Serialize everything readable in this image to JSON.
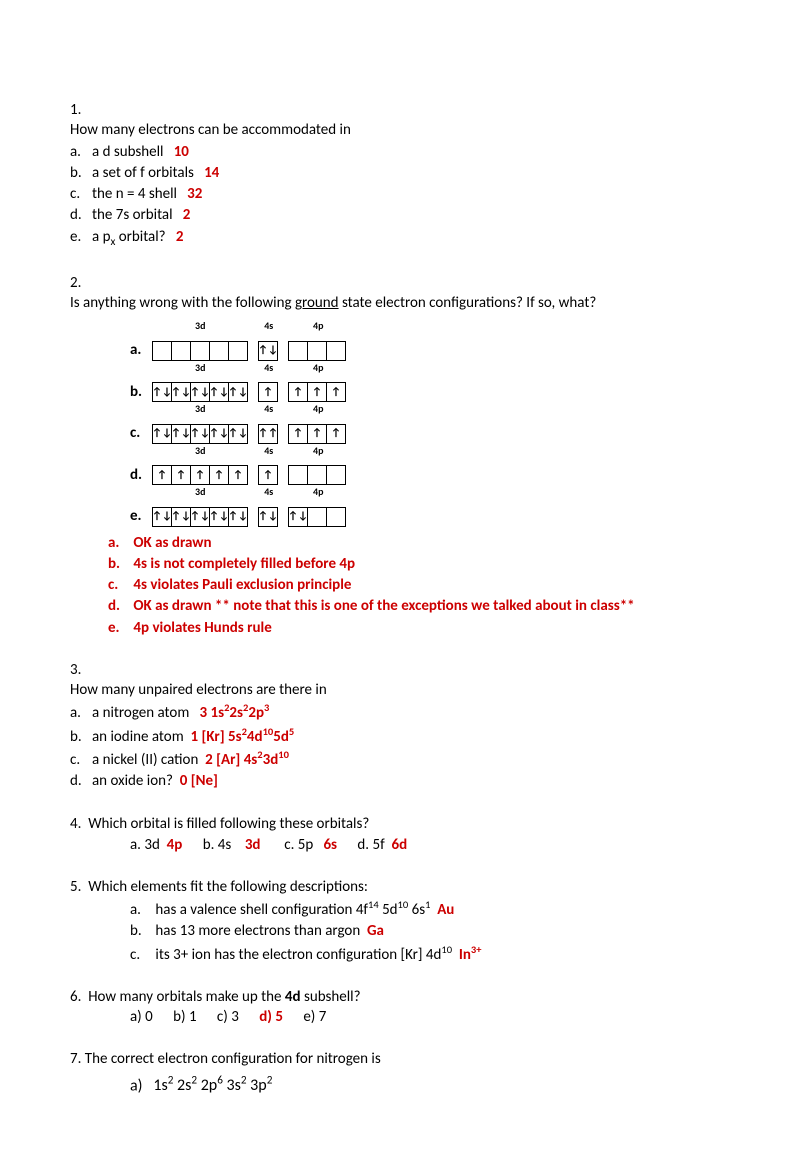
{
  "q1": {
    "num": "1.",
    "stem": "How many electrons can be accommodated in",
    "items": [
      {
        "let": "a.",
        "text": "a d subshell",
        "ans": "10"
      },
      {
        "let": "b.",
        "text": "a set of f orbitals",
        "ans": "14"
      },
      {
        "let": "c.",
        "text": "the n = 4 shell",
        "ans": "32"
      },
      {
        "let": "d.",
        "text": "the 7s orbital",
        "ans": "2"
      },
      {
        "let": "e.",
        "text_pre": "a p",
        "text_sub": "x",
        "text_post": " orbital?",
        "ans": "2"
      }
    ]
  },
  "q2": {
    "num": "2.",
    "stem_pre": "Is anything wrong with the following ",
    "stem_u": "ground",
    "stem_post": " state electron configurations?  If so, what?",
    "orbitals": {
      "headers": [
        "3d",
        "4s",
        "4p"
      ],
      "rows": [
        {
          "let": "a.",
          "d": [
            "",
            "",
            "",
            "",
            ""
          ],
          "s": [
            "↑↓"
          ],
          "p": [
            "",
            "",
            ""
          ]
        },
        {
          "let": "b.",
          "d": [
            "↑↓",
            "↑↓",
            "↑↓",
            "↑↓",
            "↑↓"
          ],
          "s": [
            "↑"
          ],
          "p": [
            "↑",
            "↑",
            "↑"
          ]
        },
        {
          "let": "c.",
          "d": [
            "↑↓",
            "↑↓",
            "↑↓",
            "↑↓",
            "↑↓"
          ],
          "s": [
            "↑↑"
          ],
          "p": [
            "↑",
            "↑",
            "↑"
          ]
        },
        {
          "let": "d.",
          "d": [
            "↑",
            "↑",
            "↑",
            "↑",
            "↑"
          ],
          "s": [
            "↑"
          ],
          "p": [
            "",
            "",
            ""
          ]
        },
        {
          "let": "e.",
          "d": [
            "↑↓",
            "↑↓",
            "↑↓",
            "↑↓",
            "↑↓"
          ],
          "s": [
            "↑↓"
          ],
          "p": [
            "↑↓",
            "",
            ""
          ]
        }
      ]
    },
    "answers": [
      {
        "let": "a.",
        "text": "OK as drawn"
      },
      {
        "let": "b.",
        "text": "4s is not completely filled before 4p"
      },
      {
        "let": "c.",
        "text": "4s violates Pauli exclusion principle"
      },
      {
        "let": "d.",
        "text": "OK as drawn  ** note that this is one of the exceptions we talked about in class**"
      },
      {
        "let": "e.",
        "text": "4p violates Hunds rule"
      }
    ]
  },
  "q3": {
    "num": "3.",
    "stem": "How many unpaired electrons are there in",
    "items": [
      {
        "let": "a.",
        "text": "a nitrogen atom",
        "ans": "3   1s",
        "cfg": [
          [
            "2",
            "2s"
          ],
          [
            "2",
            "2p"
          ],
          [
            "3",
            ""
          ]
        ]
      },
      {
        "let": "b.",
        "text": "an iodine atom",
        "ans": "1   [Kr] 5s",
        "cfg": [
          [
            "2",
            "4d"
          ],
          [
            "10",
            "5d"
          ],
          [
            "5",
            ""
          ]
        ]
      },
      {
        "let": "c.",
        "text": "a nickel (II) cation",
        "ans": "2   [Ar] 4s",
        "cfg": [
          [
            "2",
            "3d"
          ],
          [
            "10",
            ""
          ]
        ]
      },
      {
        "let": "d.",
        "text": "an oxide ion?",
        "ans": "0   [Ne]",
        "cfg": []
      }
    ]
  },
  "q4": {
    "num": "4.",
    "stem": "Which orbital is filled following these orbitals?",
    "opts": [
      {
        "let": "a.",
        "q": "3d",
        "ans": "4p"
      },
      {
        "let": "b.",
        "q": "4s",
        "ans": "3d"
      },
      {
        "let": "c.",
        "q": "5p",
        "ans": "6s"
      },
      {
        "let": "d.",
        "q": "5f",
        "ans": "6d"
      }
    ]
  },
  "q5": {
    "num": "5.",
    "stem": "Which elements fit the following descriptions:",
    "items": [
      {
        "let": "a.",
        "text_pre": "has a valence shell configuration 4f",
        "cfg": [
          [
            "14",
            " 5d"
          ],
          [
            "10",
            " 6s"
          ],
          [
            "1",
            ""
          ]
        ],
        "ans": "Au"
      },
      {
        "let": "b.",
        "text": "has 13 more electrons than argon",
        "ans": "Ga"
      },
      {
        "let": "c.",
        "text_pre": "its 3+ ion has the electron configuration [Kr] 4d",
        "cfg": [
          [
            "10",
            ""
          ]
        ],
        "ans_pre": "In",
        "ans_sup": "3+"
      }
    ]
  },
  "q6": {
    "num": "6.",
    "stem_pre": "How many orbitals make up the ",
    "stem_b": "4d",
    "stem_post": " subshell?",
    "opts": [
      {
        "let": "a)",
        "v": "0"
      },
      {
        "let": "b)",
        "v": "1"
      },
      {
        "let": "c)",
        "v": "3"
      },
      {
        "let": "d)",
        "v": "5",
        "correct": true
      },
      {
        "let": "e)",
        "v": "7"
      }
    ]
  },
  "q7": {
    "num": "7.",
    "stem": "The correct electron configuration for nitrogen is",
    "opt_let": "a)",
    "cfg_parts": [
      {
        "base": "1s",
        "sup": "2"
      },
      {
        "base": " 2s",
        "sup": "2"
      },
      {
        "base": " 2p",
        "sup": "6"
      },
      {
        "base": " 3s",
        "sup": "2"
      },
      {
        "base": " 3p",
        "sup": "2"
      }
    ]
  }
}
